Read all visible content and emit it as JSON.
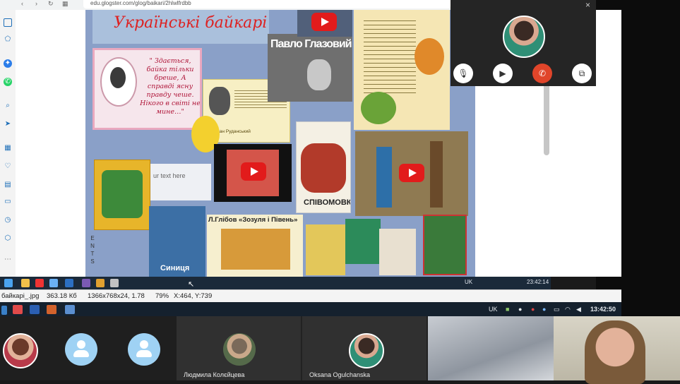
{
  "browser": {
    "url": "edu.glogster.com/glog/baikari/2hlwlfrdbb"
  },
  "glog": {
    "title": "Українські байкарі",
    "quote": "\" Здається, байка тільки бреше, А справді ясну правду чеше. Нікого в світі не мине…\"",
    "placeholder": "ur text here",
    "panel_pavlo": "Павло Глазовий",
    "rudansky_caption": "Степан Руданський",
    "spivomovky": "СПІВОМОВКИ",
    "glibov_title": "Л.Глібов «Зозуля і Півень»",
    "synytsia": "Синиця",
    "side_letters": "E N T S"
  },
  "inner_taskbar": {
    "lang": "UK",
    "time": "23:42:14"
  },
  "viewer_status": {
    "filename": "байкарі_.jpg",
    "size": "363.18 Кб",
    "dims": "1366x768x24, 1.78",
    "zoom": "79%",
    "coords": "X:464, Y:739"
  },
  "outer_taskbar": {
    "lang": "UK",
    "time": "13:42:50"
  },
  "call": {
    "mic_icon": "microphone-icon",
    "video_icon": "camera-icon",
    "hangup_icon": "hang-up-icon",
    "popout_icon": "popout-icon",
    "close_label": "×"
  },
  "participants": [
    {
      "name": ""
    },
    {
      "name": ""
    },
    {
      "name": ""
    },
    {
      "name": "Людмила Колєйцева"
    },
    {
      "name": "Oksana Ogulchanska"
    },
    {
      "name": ""
    },
    {
      "name": ""
    }
  ],
  "colors": {
    "hangup": "#e0452a",
    "youtube": "#e21b1b",
    "taskbar": "#15212e"
  }
}
